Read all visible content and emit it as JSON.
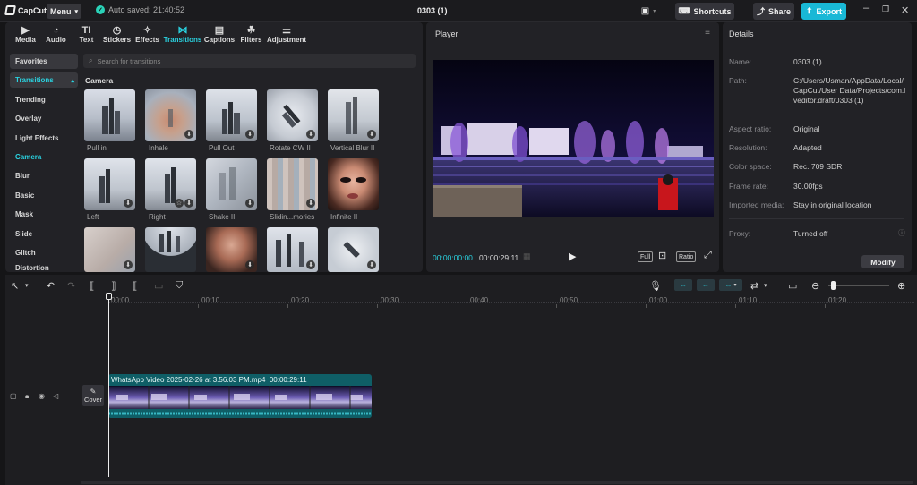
{
  "titlebar": {
    "app_name": "CapCut",
    "menu_label": "Menu",
    "autosave": "Auto saved: 21:40:52",
    "project_title": "0303 (1)",
    "shortcuts_label": "Shortcuts",
    "share_label": "Share",
    "export_label": "Export"
  },
  "toptabs": [
    {
      "label": "Media",
      "icon": "media-icon"
    },
    {
      "label": "Audio",
      "icon": "audio-icon"
    },
    {
      "label": "Text",
      "icon": "text-icon"
    },
    {
      "label": "Stickers",
      "icon": "sticker-icon"
    },
    {
      "label": "Effects",
      "icon": "effects-icon"
    },
    {
      "label": "Transitions",
      "icon": "transitions-icon"
    },
    {
      "label": "Captions",
      "icon": "captions-icon"
    },
    {
      "label": "Filters",
      "icon": "filters-icon"
    },
    {
      "label": "Adjustment",
      "icon": "adjustment-icon"
    }
  ],
  "sidebar": {
    "items": [
      "Favorites",
      "Transitions",
      "Trending",
      "Overlay",
      "Light Effects",
      "Camera",
      "Blur",
      "Basic",
      "Mask",
      "Slide",
      "Glitch",
      "Distortion"
    ]
  },
  "search": {
    "placeholder": "Search for transitions"
  },
  "category_title": "Camera",
  "thumbs": {
    "row1": [
      "Pull in",
      "Inhale",
      "Pull Out",
      "Rotate CW II",
      "Vertical Blur II"
    ],
    "row2": [
      "Left",
      "Right",
      "Shake II",
      "Slidin...mories",
      "Infinite II"
    ]
  },
  "player": {
    "header": "Player",
    "current_time": "00:00:00:00",
    "total_time": "00:00:29:11",
    "full_label": "Full",
    "ratio_label": "Ratio"
  },
  "details": {
    "header": "Details",
    "rows": [
      {
        "key": "Name:",
        "value": "0303 (1)"
      },
      {
        "key": "Path:",
        "value": "C:/Users/Usman/AppData/Local/CapCut/User Data/Projects/com.lveditor.draft/0303 (1)"
      },
      {
        "key": "Aspect ratio:",
        "value": "Original"
      },
      {
        "key": "Resolution:",
        "value": "Adapted"
      },
      {
        "key": "Color space:",
        "value": "Rec. 709 SDR"
      },
      {
        "key": "Frame rate:",
        "value": "30.00fps"
      },
      {
        "key": "Imported media:",
        "value": "Stay in original location"
      },
      {
        "key": "Proxy:",
        "value": "Turned off"
      }
    ],
    "modify_label": "Modify"
  },
  "timeline": {
    "ruler": [
      "00:00",
      "00:10",
      "00:20",
      "00:30",
      "00:40",
      "00:50",
      "01:00",
      "01:10",
      "01:20"
    ],
    "clip_name": "WhatsApp Video 2025-02-26 at 3.56.03 PM.mp4",
    "clip_duration": "00:00:29:11",
    "cover_label": "Cover"
  },
  "colors": {
    "accent": "#2ad2e0",
    "export": "#19b8d6",
    "clip": "#0f5e66"
  }
}
